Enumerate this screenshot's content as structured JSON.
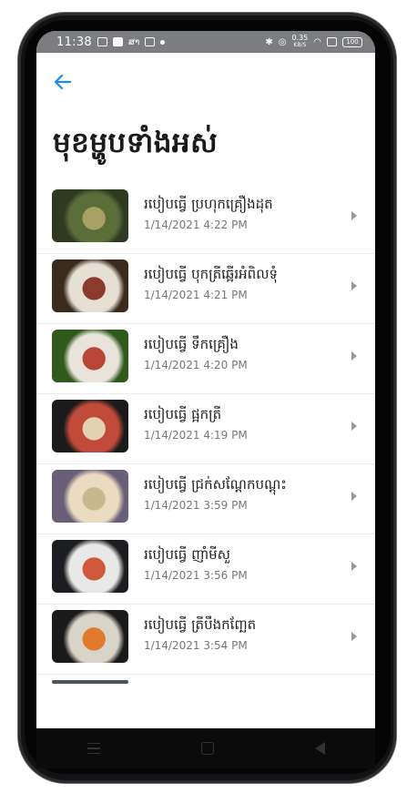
{
  "status_bar": {
    "time": "11:38",
    "carrier": "ສາ",
    "speed_value": "0.35",
    "speed_unit": "KB/S",
    "battery": "100"
  },
  "header": {
    "back_icon": "arrow-left-icon",
    "title": "មុខម្ហូបទាំងអស់"
  },
  "recipes": [
    {
      "title": "របៀបធ្វើ ប្រហុកគ្រឿងដុត",
      "date": "1/14/2021 4:22 PM",
      "colors": [
        "#2f3a20",
        "#5b6e3a",
        "#a8a064"
      ]
    },
    {
      "title": "របៀបធ្វើ បុកត្រីឆ្អើរអំពិលទុំ",
      "date": "1/14/2021 4:21 PM",
      "colors": [
        "#3a2b1d",
        "#e6e0d4",
        "#8a3b2c"
      ]
    },
    {
      "title": "របៀបធ្វើ ទឹកគ្រឿង",
      "date": "1/14/2021 4:20 PM",
      "colors": [
        "#2f5a1c",
        "#e8e4dc",
        "#b8473a"
      ]
    },
    {
      "title": "របៀបធ្វើ ផ្អកត្រី",
      "date": "1/14/2021 4:19 PM",
      "colors": [
        "#1b1b1b",
        "#c24a3a",
        "#e2d2b0"
      ]
    },
    {
      "title": "របៀបធ្វើ ជ្រក់សណ្ដែកបណ្ដុះ",
      "date": "1/14/2021 3:59 PM",
      "colors": [
        "#6a5f78",
        "#e9dcc0",
        "#c7b88e"
      ]
    },
    {
      "title": "របៀបធ្វើ ញាំមីសួ",
      "date": "1/14/2021 3:56 PM",
      "colors": [
        "#1c1d20",
        "#e8e8e6",
        "#d0583a"
      ]
    },
    {
      "title": "របៀបធ្វើ ត្រីបឹងកញ្ឆែត",
      "date": "1/14/2021 3:54 PM",
      "colors": [
        "#1a1a1a",
        "#d9d4c8",
        "#e07a2c"
      ]
    }
  ],
  "nav": {
    "menu_icon": "menu-icon",
    "home_icon": "home-icon",
    "back_icon": "back-triangle-icon"
  }
}
